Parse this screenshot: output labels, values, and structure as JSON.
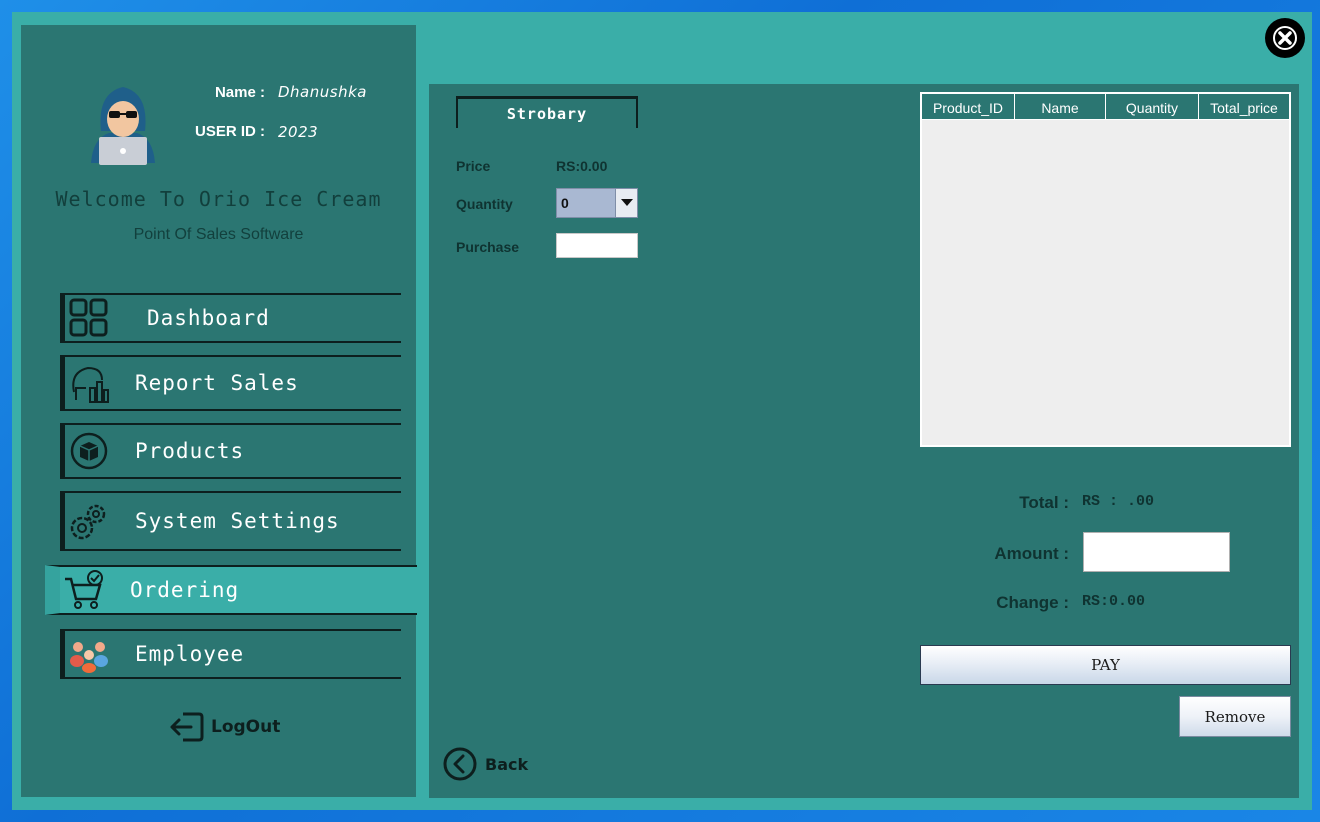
{
  "colors": {
    "window": "#3aaea8",
    "panel": "#2b7672",
    "active_nav": "#3aaea8"
  },
  "profile": {
    "name_label": "Name :",
    "name_value": "Dhanushka",
    "userid_label": "USER ID :",
    "userid_value": "2023",
    "welcome": "Welcome To Orio Ice Cream",
    "subtitle": "Point Of Sales Software"
  },
  "nav": {
    "items": [
      {
        "label": "Dashboard",
        "icon": "dashboard-icon"
      },
      {
        "label": "Report Sales",
        "icon": "report-icon"
      },
      {
        "label": "Products",
        "icon": "box-icon"
      },
      {
        "label": "System Settings",
        "icon": "gear-icon"
      },
      {
        "label": "Ordering",
        "icon": "cart-icon",
        "active": true
      },
      {
        "label": "Employee",
        "icon": "people-icon"
      }
    ],
    "logout": "LogOut"
  },
  "order": {
    "product_tab": "Strobary",
    "price_label": "Price",
    "price_value": "RS:0.00",
    "quantity_label": "Quantity",
    "quantity_value": "0",
    "purchase_label": "Purchase",
    "purchase_value": ""
  },
  "table": {
    "columns": [
      "Product_ID",
      "Name",
      "Quantity",
      "Total_price"
    ],
    "rows": []
  },
  "summary": {
    "total_label": "Total :",
    "total_value": "RS : .00",
    "amount_label": "Amount :",
    "amount_value": "",
    "change_label": "Change :",
    "change_value": "RS:0.00"
  },
  "buttons": {
    "pay": "PAY",
    "remove": "Remove",
    "back": "Back"
  }
}
